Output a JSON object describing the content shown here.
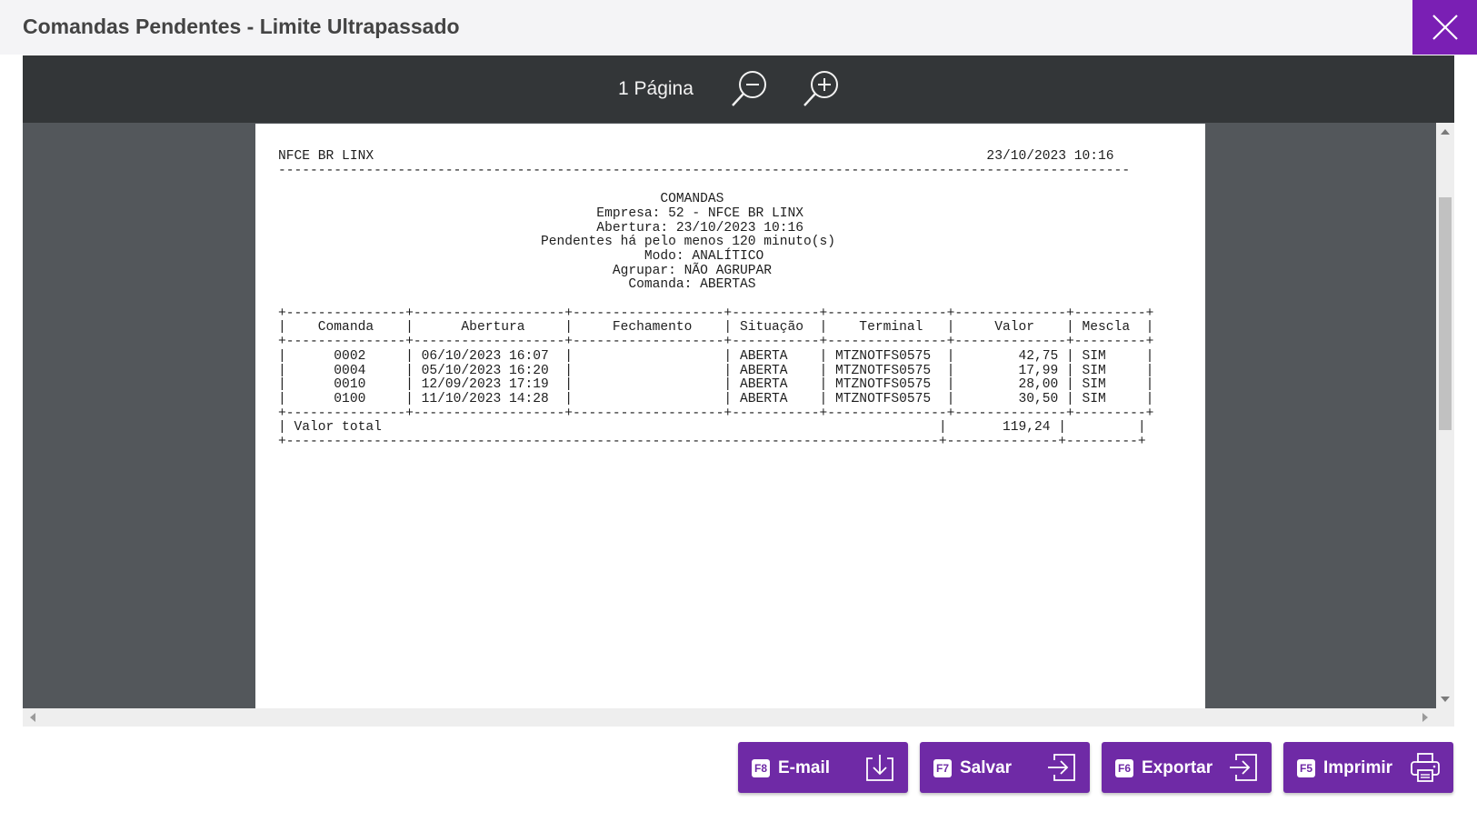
{
  "dialog": {
    "title": "Comandas Pendentes - Limite Ultrapassado"
  },
  "viewer": {
    "page_count": "1 Página",
    "report_lines": [
      "NFCE BR LINX                                                                             23/10/2023 10:16",
      "-----------------------------------------------------------------------------------------------------------",
      "",
      "                                                COMANDAS",
      "                                        Empresa: 52 - NFCE BR LINX",
      "                                        Abertura: 23/10/2023 10:16",
      "                                 Pendentes há pelo menos 120 minuto(s)",
      "                                              Modo: ANALÍTICO",
      "                                          Agrupar: NÃO AGRUPAR",
      "                                            Comanda: ABERTAS",
      "",
      "+---------------+-------------------+-------------------+-----------+---------------+--------------+---------+",
      "|    Comanda    |      Abertura     |     Fechamento    | Situação  |    Terminal   |     Valor    | Mescla  |",
      "+---------------+-------------------+-------------------+-----------+---------------+--------------+---------+",
      "|      0002     | 06/10/2023 16:07  |                   | ABERTA    | MTZNOTFS0575  |        42,75 | SIM     |",
      "|      0004     | 05/10/2023 16:20  |                   | ABERTA    | MTZNOTFS0575  |        17,99 | SIM     |",
      "|      0010     | 12/09/2023 17:19  |                   | ABERTA    | MTZNOTFS0575  |        28,00 | SIM     |",
      "|      0100     | 11/10/2023 14:28  |                   | ABERTA    | MTZNOTFS0575  |        30,50 | SIM     |",
      "+---------------+-------------------+-------------------+-----------+---------------+--------------+---------+",
      "| Valor total                                                                      |       119,24 |         |",
      "+----------------------------------------------------------------------------------+--------------+---------+"
    ]
  },
  "buttons": {
    "email": {
      "key": "F8",
      "label": "E-mail"
    },
    "salvar": {
      "key": "F7",
      "label": "Salvar"
    },
    "exportar": {
      "key": "F6",
      "label": "Exportar"
    },
    "imprimir": {
      "key": "F5",
      "label": "Imprimir"
    }
  },
  "icons": {
    "close": "close-icon",
    "zoom_out": "zoom-out-icon",
    "zoom_in": "zoom-in-icon",
    "email": "download-icon",
    "salvar": "enter-icon",
    "exportar": "export-icon",
    "imprimir": "printer-icon"
  },
  "colors": {
    "accent": "#7a1fb4",
    "button": "#6f2aa6",
    "viewer_bg": "#53575b",
    "toolbar_bg": "#333638"
  }
}
